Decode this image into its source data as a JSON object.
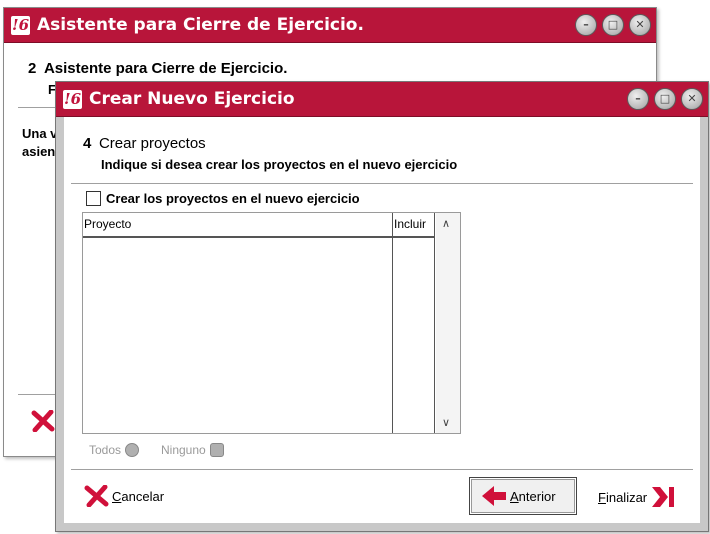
{
  "background_window": {
    "title": "Asistente para Cierre de Ejercicio.",
    "step_number": "2",
    "step_title": "Asistente para Cierre de Ejercicio.",
    "subtitle_fragment": "F",
    "body_fragment_line1": "Una v",
    "body_fragment_line2": "asien"
  },
  "dialog": {
    "title": "Crear Nuevo Ejercicio",
    "step_number": "4",
    "step_title": "Crear proyectos",
    "subtitle": "Indique si desea crear los proyectos en el nuevo ejercicio",
    "checkbox_label": "Crear los proyectos en el nuevo ejercicio",
    "checkbox_checked": false,
    "table": {
      "columns": [
        "Proyecto",
        "Incluir"
      ],
      "rows": []
    },
    "select_all_label": "Todos",
    "select_none_label": "Ninguno",
    "cancel_label_first": "C",
    "cancel_label_rest": "ancelar",
    "back_label_first": "A",
    "back_label_rest": "nterior",
    "finish_label_first": "F",
    "finish_label_rest": "inalizar"
  },
  "colors": {
    "titlebar": "#b8153a",
    "accent_red": "#d0103a"
  }
}
